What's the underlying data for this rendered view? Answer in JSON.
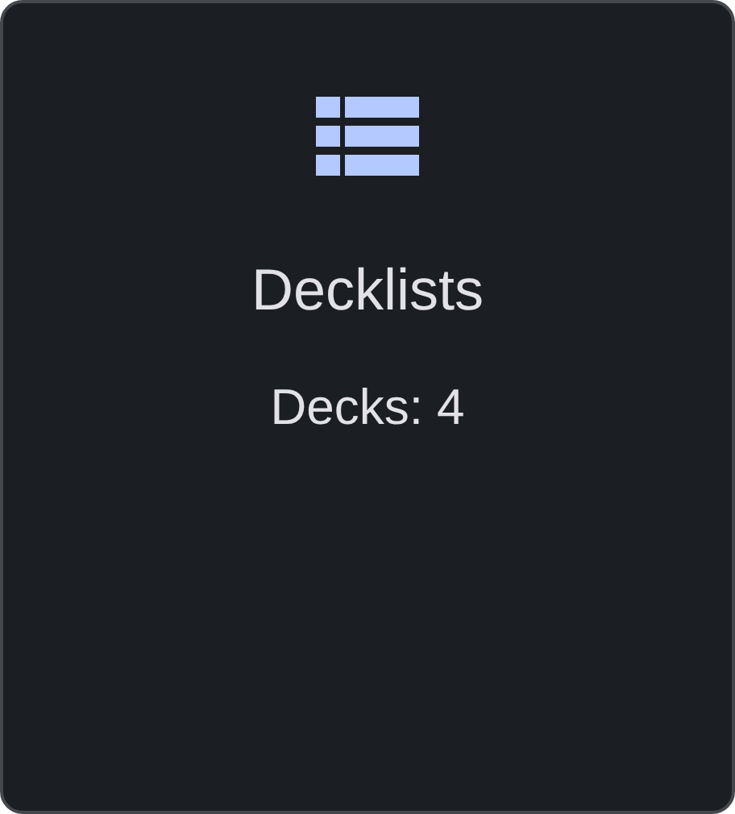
{
  "card": {
    "title": "Decklists",
    "subtitle": "Decks: 4"
  }
}
